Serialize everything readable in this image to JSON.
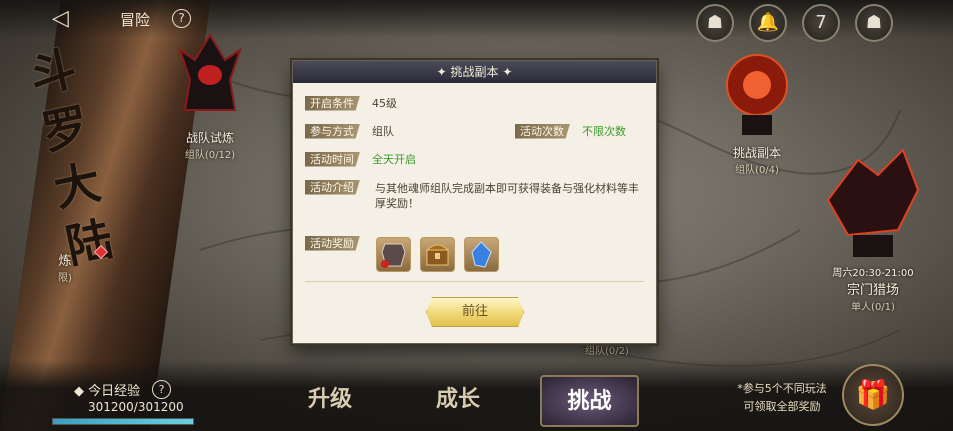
{
  "header": {
    "title": "冒险",
    "help_label": "?",
    "back_icon": "back-arrow-icon"
  },
  "top_icons": [
    "mask-icon",
    "bell-settings-icon",
    "calendar-icon",
    "mask-icon"
  ],
  "calendar_day": "7",
  "scroll_text": "斗罗大陆",
  "map_nodes": [
    {
      "name": "战队试炼",
      "sub": "组队(0/12)"
    },
    {
      "name": "挑战副本",
      "sub": "组队(0/4)"
    },
    {
      "name": "宗门猎场",
      "sub": "单人(0/1)",
      "time": "周六20:30-21:00"
    },
    {
      "name": "炼",
      "sub": "限)"
    },
    {
      "sub": "组队(0/2)"
    }
  ],
  "modal": {
    "title": "挑战副本",
    "rows": {
      "requirement_label": "开启条件",
      "requirement_value": "45级",
      "mode_label": "参与方式",
      "mode_value": "组队",
      "times_label": "活动次数",
      "times_value": "不限次数",
      "time_label": "活动时间",
      "time_value": "全天开启",
      "intro_label": "活动介绍",
      "intro_value": "与其他魂师组队完成副本即可获得装备与强化材料等丰厚奖励！",
      "reward_label": "活动奖励"
    },
    "rewards": [
      "armor-chest-icon",
      "treasure-chest-icon",
      "blue-crystal-icon"
    ],
    "go_button": "前往"
  },
  "bottom": {
    "exp_label": "今日经验",
    "exp_help": "?",
    "exp_value": "301200/301200",
    "exp_progress": 1.0,
    "tabs": [
      "升级",
      "成长",
      "挑战"
    ],
    "active_tab": "挑战",
    "hint_line1": "*参与5个不同玩法",
    "hint_line2": "可领取全部奖励"
  },
  "colors": {
    "green": "#3c9a2c",
    "tag_bg": "#a89470",
    "modal_bg": "#f4f0e6"
  }
}
